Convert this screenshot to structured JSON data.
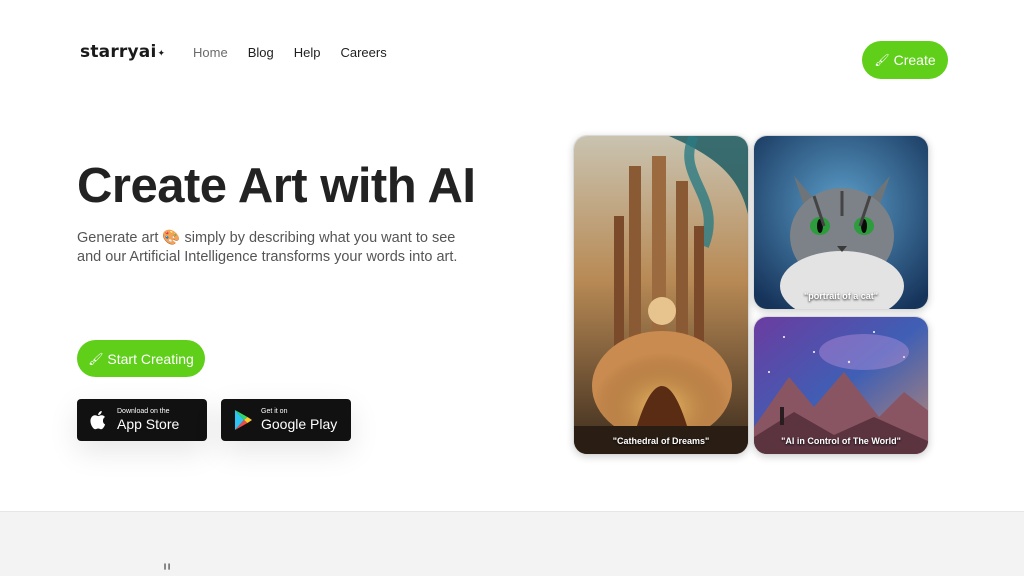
{
  "header": {
    "logo": "starryai",
    "nav": [
      "Home",
      "Blog",
      "Help",
      "Careers"
    ],
    "create_label": "Create"
  },
  "hero": {
    "title": "Create Art with AI",
    "subtitle_line1": "Generate art 🎨 simply by describing what you want to see",
    "subtitle_line2": "and our Artificial Intelligence transforms your words into art.",
    "start_label": "Start Creating"
  },
  "stores": {
    "apple_small": "Download on the",
    "apple_big": "App Store",
    "google_small": "Get it on",
    "google_big": "Google Play"
  },
  "gallery": [
    {
      "caption": "\"Cathedral of Dreams\""
    },
    {
      "caption": "\"portrait of a cat\""
    },
    {
      "caption": "\"AI in Control of The World\""
    }
  ],
  "testimonial": {
    "mark": "\"",
    "text": "..."
  },
  "colors": {
    "accent": "#5fcf1a",
    "dark": "#111111"
  }
}
